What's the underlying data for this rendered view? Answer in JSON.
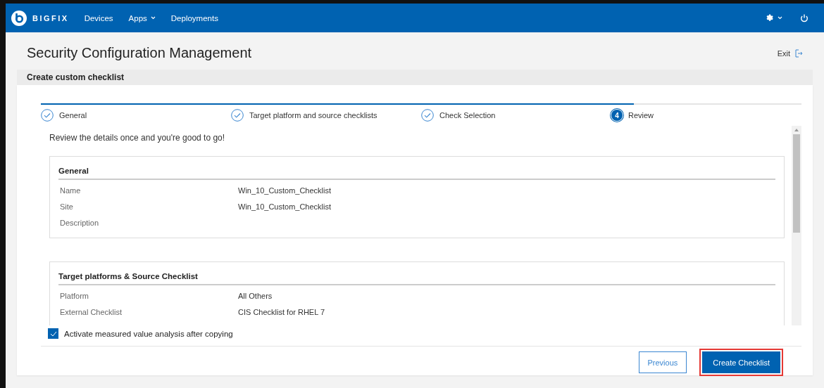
{
  "header": {
    "brand": "BIGFIX",
    "nav": [
      {
        "label": "Devices",
        "dropdown": false
      },
      {
        "label": "Apps",
        "dropdown": true
      },
      {
        "label": "Deployments",
        "dropdown": false
      }
    ]
  },
  "page": {
    "title": "Security Configuration Management",
    "exit": "Exit"
  },
  "panel": {
    "title": "Create custom checklist"
  },
  "steps": [
    {
      "label": "General",
      "selected": false
    },
    {
      "label": "Target platform and source checklists",
      "selected": false
    },
    {
      "label": "Check Selection",
      "selected": false
    },
    {
      "label": "Review",
      "number": "4",
      "selected": true
    }
  ],
  "intro": "Review the details once and you're good to go!",
  "sections": [
    {
      "title": "General",
      "rows": [
        {
          "label": "Name",
          "value": "Win_10_Custom_Checklist"
        },
        {
          "label": "Site",
          "value": "Win_10_Custom_Checklist"
        },
        {
          "label": "Description"
        }
      ]
    },
    {
      "title": "Target platforms & Source Checklist",
      "rows": [
        {
          "label": "Platform",
          "value": "All Others"
        },
        {
          "label": "External Checklist",
          "value": "CIS Checklist for RHEL 7"
        }
      ]
    }
  ],
  "option": {
    "label": "Activate measured value analysis after copying",
    "checked": true
  },
  "buttons": [
    {
      "label": "Previous",
      "kind": "secondary"
    },
    {
      "label": "Create Checklist",
      "kind": "primary"
    }
  ]
}
